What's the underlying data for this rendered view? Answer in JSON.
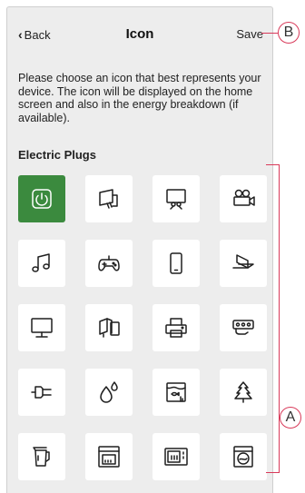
{
  "header": {
    "back_label": "Back",
    "title": "Icon",
    "save_label": "Save"
  },
  "description": "Please choose an icon that best represents your device. The icon will be displayed on the home screen and also in the energy breakdown (if available).",
  "section_title": "Electric Plugs",
  "icons": [
    {
      "name": "power-icon",
      "selected": true
    },
    {
      "name": "hand-dryer-icon"
    },
    {
      "name": "projector-screen-icon"
    },
    {
      "name": "video-camera-icon"
    },
    {
      "name": "music-note-icon"
    },
    {
      "name": "gamepad-icon"
    },
    {
      "name": "mobile-phone-icon"
    },
    {
      "name": "laptop-icon"
    },
    {
      "name": "monitor-icon"
    },
    {
      "name": "desktop-computer-icon"
    },
    {
      "name": "printer-icon"
    },
    {
      "name": "power-strip-icon"
    },
    {
      "name": "plug-icon"
    },
    {
      "name": "water-drops-icon"
    },
    {
      "name": "aquarium-icon"
    },
    {
      "name": "christmas-tree-icon"
    },
    {
      "name": "kettle-icon"
    },
    {
      "name": "oven-icon"
    },
    {
      "name": "microwave-icon"
    },
    {
      "name": "washing-machine-icon"
    }
  ],
  "callouts": {
    "a": "A",
    "b": "B"
  },
  "colors": {
    "selected": "#3b8a3e",
    "callout": "#d93a5a",
    "background": "#ededed"
  }
}
